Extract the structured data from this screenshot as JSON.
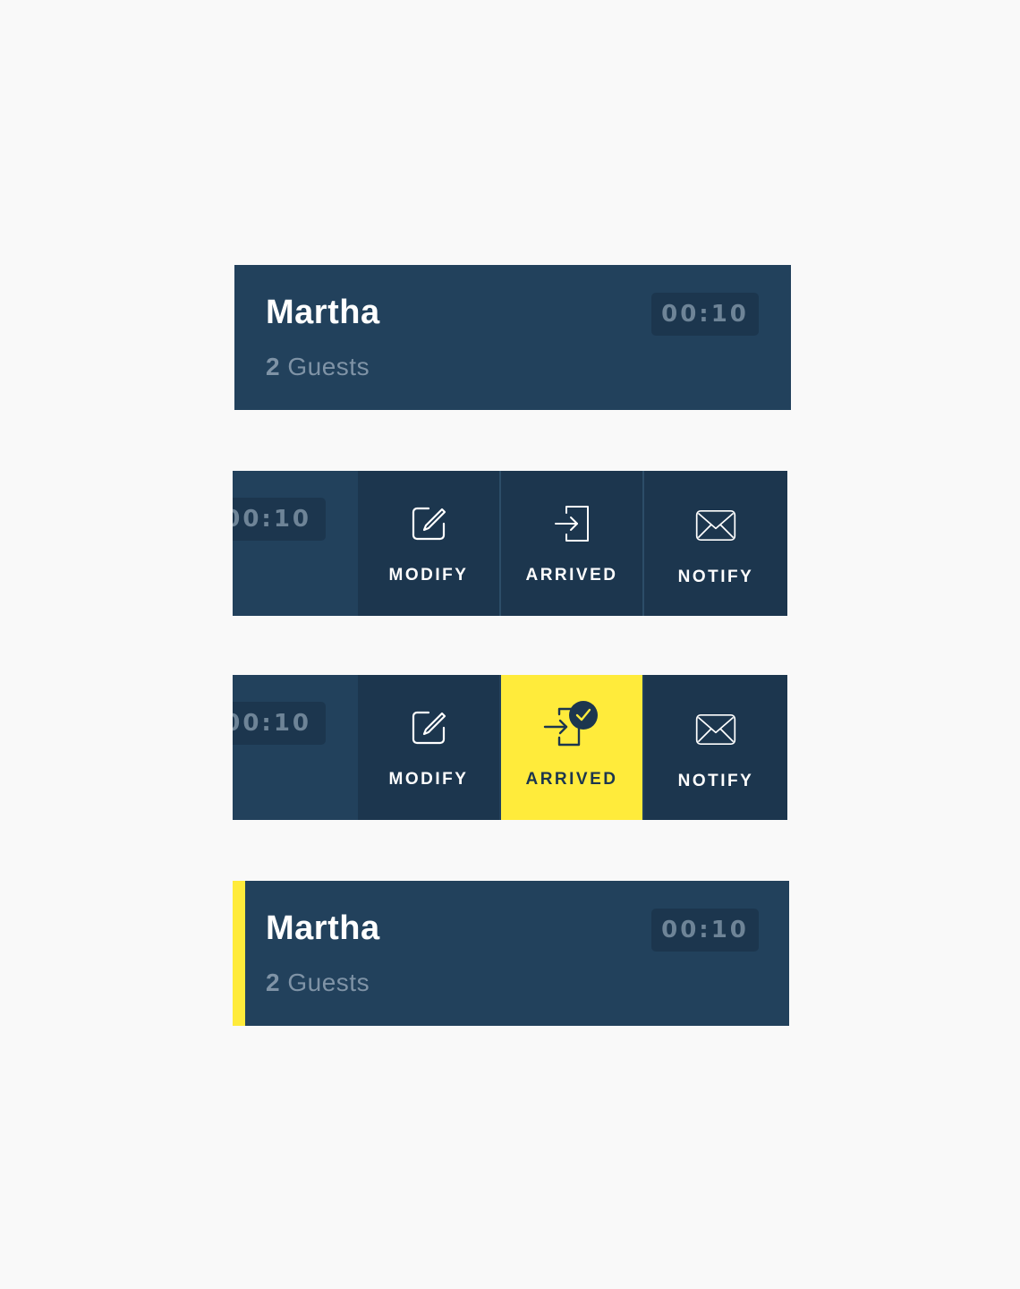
{
  "colors": {
    "background": "#f9f9f9",
    "card": "#22415c",
    "action_bg": "#1c364e",
    "accent_yellow": "#ffeb3b",
    "muted_text": "#7f93a6"
  },
  "card_collapsed": {
    "name": "Martha",
    "guest_count": "2",
    "guest_label": "Guests",
    "timer": "00:10"
  },
  "card_swiped": {
    "timer_partial": "00:10",
    "actions": [
      {
        "label": "MODIFY",
        "icon": "edit-icon"
      },
      {
        "label": "ARRIVED",
        "icon": "sign-in-icon"
      },
      {
        "label": "NOTIFY",
        "icon": "envelope-icon"
      }
    ]
  },
  "card_swiped_arrived": {
    "timer_partial": "00:10",
    "actions": [
      {
        "label": "MODIFY",
        "icon": "edit-icon"
      },
      {
        "label": "ARRIVED",
        "icon": "sign-in-check-icon",
        "selected": true
      },
      {
        "label": "NOTIFY",
        "icon": "envelope-icon"
      }
    ]
  },
  "card_arrived": {
    "name": "Martha",
    "guest_count": "2",
    "guest_label": "Guests",
    "timer": "00:10"
  }
}
